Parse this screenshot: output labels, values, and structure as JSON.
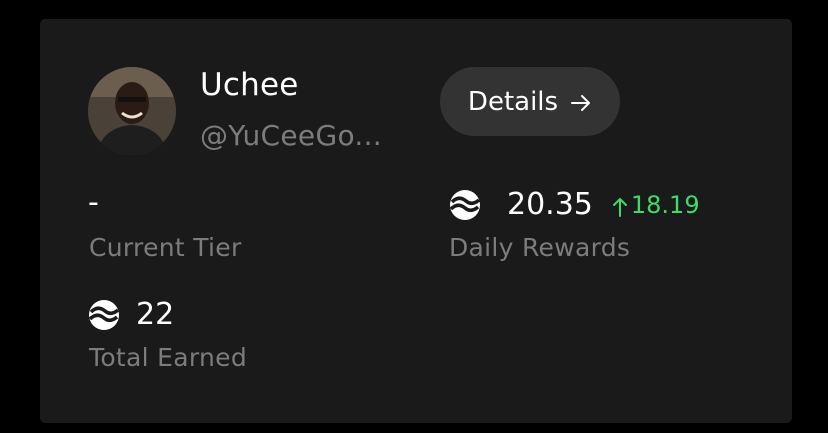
{
  "profile": {
    "name": "Uchee",
    "handle": "@YuCeeGo..."
  },
  "details_button": {
    "label": "Details",
    "icon": "arrow-right-icon"
  },
  "stats": {
    "current_tier": {
      "value": "-",
      "label": "Current Tier"
    },
    "daily_rewards": {
      "value": "20.35",
      "change": "18.19",
      "change_direction": "up",
      "label": "Daily Rewards",
      "icon": "token-logo-icon"
    },
    "total_earned": {
      "value": "22",
      "label": "Total Earned",
      "icon": "token-logo-icon"
    }
  },
  "colors": {
    "page_bg": "#000000",
    "card_bg": "#1a1a1a",
    "button_bg": "#333333",
    "text_primary": "#ffffff",
    "text_secondary": "#7c7c7c",
    "positive": "#3ddc6a"
  }
}
